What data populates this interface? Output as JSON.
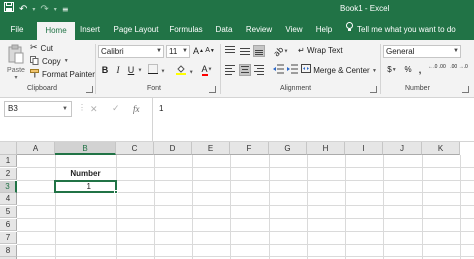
{
  "title_bar": {
    "window_title": "Book1 - Excel",
    "qat_icons": [
      "save-icon",
      "undo-icon",
      "redo-icon",
      "customize-icon"
    ],
    "brand_color": "#217346"
  },
  "tabs": {
    "file": "File",
    "home": "Home",
    "insert": "Insert",
    "page_layout": "Page Layout",
    "formulas": "Formulas",
    "data": "Data",
    "review": "Review",
    "view": "View",
    "help": "Help",
    "tell_me": "Tell me what you want to do"
  },
  "ribbon": {
    "clipboard": {
      "paste": "Paste",
      "cut": "Cut",
      "copy": "Copy",
      "format_painter": "Format Painter",
      "label": "Clipboard"
    },
    "font": {
      "font_name": "Calibri",
      "font_size": "11",
      "increase_size": "A",
      "decrease_size": "A",
      "bold": "B",
      "italic": "I",
      "underline": "U",
      "font_color_letter": "A",
      "label": "Font",
      "highlight_color": "#ffff00",
      "font_color": "#ff0000"
    },
    "alignment": {
      "wrap_text": "Wrap Text",
      "merge_center": "Merge & Center",
      "label": "Alignment"
    },
    "number": {
      "format": "General",
      "currency": "$",
      "percent": "%",
      "comma": ",",
      "increase_decimal": "←.0 .00",
      "decrease_decimal": ".00 →.0",
      "label": "Number"
    }
  },
  "formula_bar": {
    "name_box": "B3",
    "cancel": "✕",
    "enter": "✓",
    "function": "fx",
    "content": "1"
  },
  "grid": {
    "columns": [
      "A",
      "B",
      "C",
      "D",
      "E",
      "F",
      "G",
      "H",
      "I",
      "J",
      "K"
    ],
    "rows": [
      "1",
      "2",
      "3",
      "4",
      "5",
      "6",
      "7",
      "8",
      "9"
    ],
    "selected_column": "B",
    "selected_row": "3",
    "cells": {
      "B2": "Number",
      "B3": "1"
    }
  }
}
